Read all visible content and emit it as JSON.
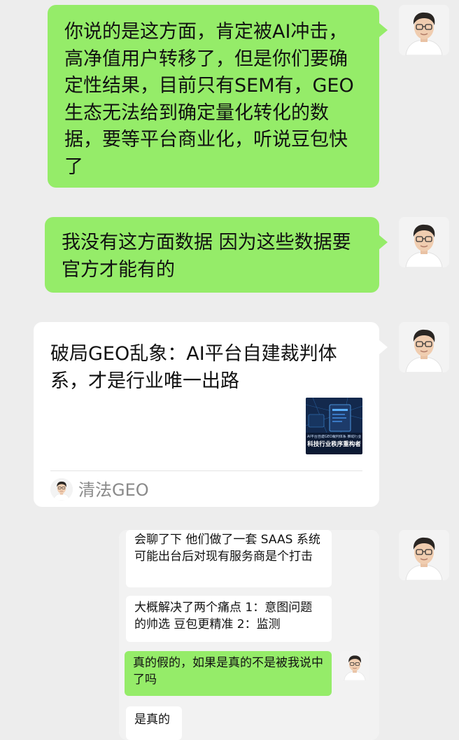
{
  "messages": [
    {
      "id": "m1",
      "type": "text",
      "side": "right",
      "text": "你说的是这方面，肯定被AI冲击，高净值用户转移了，但是你们要确定性结果，目前只有SEM有，GEO生态无法给到确定量化转化的数据，要等平台商业化，听说豆包快了"
    },
    {
      "id": "m2",
      "type": "text",
      "side": "right",
      "text": "我没有这方面数据 因为这些数据要官方才能有的"
    },
    {
      "id": "m3",
      "type": "link-card",
      "side": "right",
      "title": "破局GEO乱象：AI平台自建裁判体系，才是行业唯一出路",
      "source": "清法GEO",
      "thumb_caption_small": "AI平台自建GEO裁判体系 推动行业重构",
      "thumb_caption_big": "科技行业秩序重构者"
    },
    {
      "id": "m4",
      "type": "chat-record",
      "side": "right",
      "items": [
        {
          "text": "会聊了下  他们做了一套 SAAS 系统 可能出台后对现有服务商是个打击",
          "style": "white"
        },
        {
          "text": "大概解决了两个痛点 1：意图问题的帅选 豆包更精准  2：监测",
          "style": "white"
        },
        {
          "text": "真的假的，如果是真的不是被我说中了吗",
          "style": "green"
        },
        {
          "text": "是真的",
          "style": "white"
        }
      ]
    }
  ],
  "colors": {
    "background": "#ededed",
    "green_bubble": "#95ec69",
    "white_bubble": "#ffffff",
    "source_text": "#8a8a8a"
  },
  "icons": {
    "avatar": "user-avatar",
    "source": "source-avatar-icon"
  }
}
